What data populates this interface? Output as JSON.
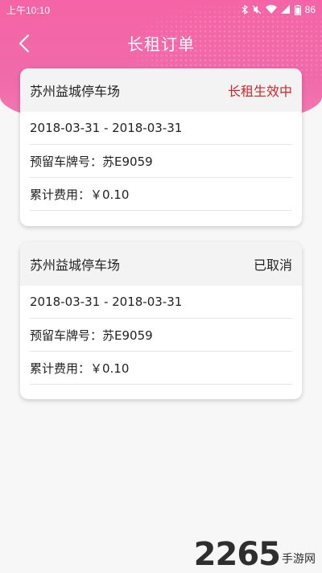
{
  "status_bar": {
    "time": "上午10:10",
    "battery": "86"
  },
  "nav": {
    "title": "长租订单"
  },
  "orders": [
    {
      "lot_name": "苏州益城停车场",
      "status": "长租生效中",
      "date_range": "2018-03-31 - 2018-03-31",
      "plate": "预留车牌号：苏E9059",
      "cost": "累计费用：￥0.10"
    },
    {
      "lot_name": "苏州益城停车场",
      "status": "已取消",
      "date_range": "2018-03-31 - 2018-03-31",
      "plate": "预留车牌号：苏E9059",
      "cost": "累计费用：￥0.10"
    }
  ],
  "watermark": {
    "number": "2265",
    "suffix": "手游网"
  },
  "colors": {
    "header_pink": "#f564a6",
    "status_active": "#d0262b"
  }
}
